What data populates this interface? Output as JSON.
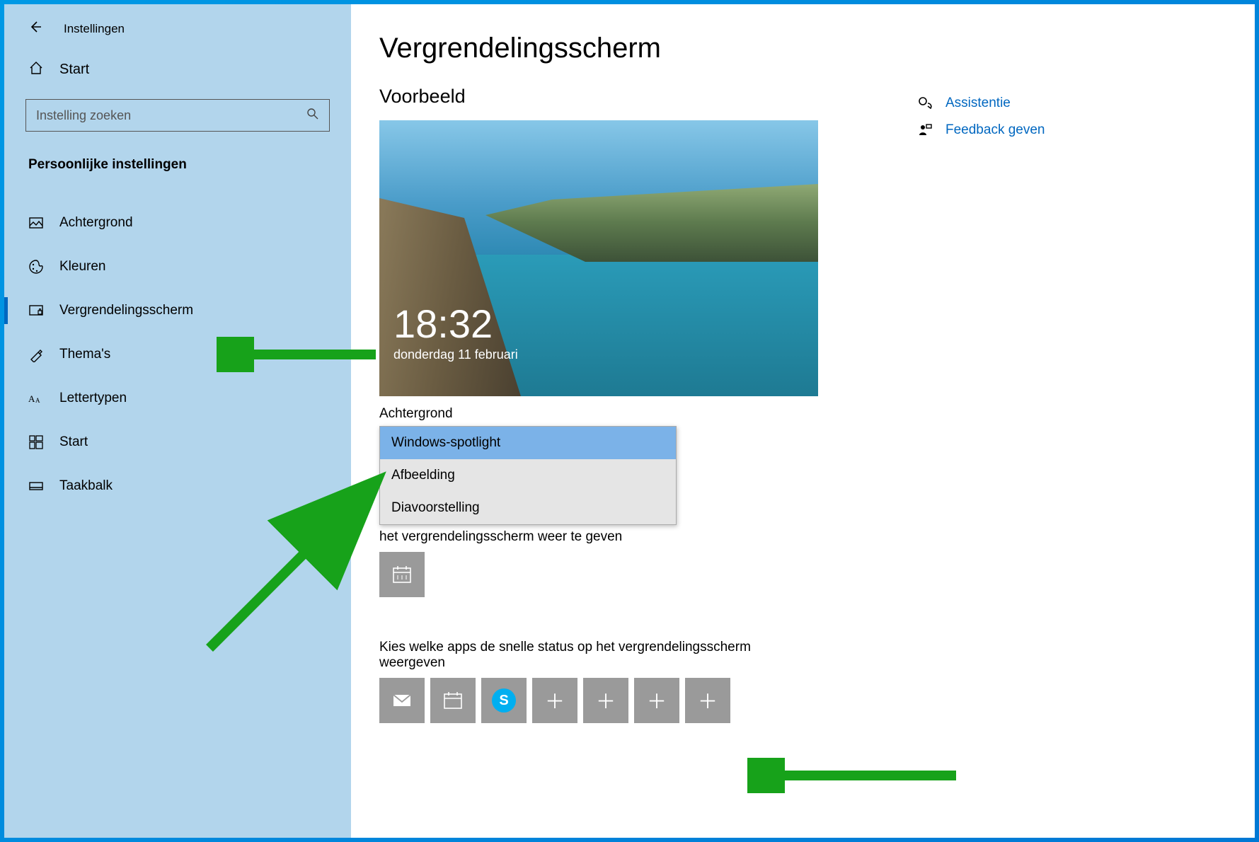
{
  "app_title": "Instellingen",
  "home_label": "Start",
  "search_placeholder": "Instelling zoeken",
  "category_label": "Persoonlijke instellingen",
  "nav": [
    {
      "label": "Achtergrond"
    },
    {
      "label": "Kleuren"
    },
    {
      "label": "Vergrendelingsscherm"
    },
    {
      "label": "Thema's"
    },
    {
      "label": "Lettertypen"
    },
    {
      "label": "Start"
    },
    {
      "label": "Taakbalk"
    }
  ],
  "page_title": "Vergrendelingsscherm",
  "preview_heading": "Voorbeeld",
  "preview_time": "18:32",
  "preview_date": "donderdag 11 februari",
  "bg_label": "Achtergrond",
  "dropdown": {
    "options": [
      "Windows-spotlight",
      "Afbeelding",
      "Diavoorstelling"
    ]
  },
  "detail_text_suffix": "het vergrendelingsscherm weer te geven",
  "quick_status_label": "Kies welke apps de snelle status op het vergrendelingsscherm weergeven",
  "help": {
    "assist": "Assistentie",
    "feedback": "Feedback geven"
  }
}
